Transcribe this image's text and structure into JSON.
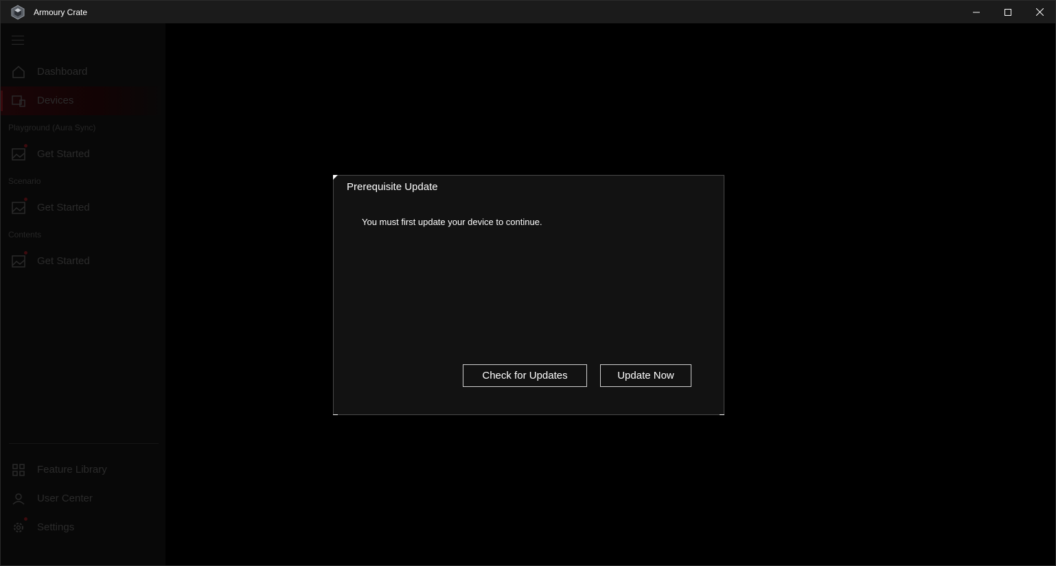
{
  "titlebar": {
    "title": "Armoury Crate",
    "minimize_icon": "minimize-icon",
    "maximize_icon": "maximize-icon",
    "close_icon": "close-icon"
  },
  "sidebar": {
    "items_top": [
      {
        "label": "Dashboard",
        "icon": "home-icon"
      },
      {
        "label": "Devices",
        "icon": "devices-icon",
        "active": true
      }
    ],
    "sections": [
      {
        "label": "Playground (Aura Sync)",
        "item": {
          "label": "Get Started",
          "icon": "image-icon"
        }
      },
      {
        "label": "Scenario",
        "item": {
          "label": "Get Started",
          "icon": "image-icon"
        }
      },
      {
        "label": "Contents",
        "item": {
          "label": "Get Started",
          "icon": "image-icon"
        }
      }
    ],
    "items_bottom": [
      {
        "label": "Feature Library",
        "icon": "grid-icon"
      },
      {
        "label": "User Center",
        "icon": "user-icon"
      },
      {
        "label": "Settings",
        "icon": "gear-icon"
      }
    ]
  },
  "dialog": {
    "title": "Prerequisite Update",
    "message": "You must first update your device to continue.",
    "check_button": "Check for Updates",
    "update_button": "Update Now"
  },
  "colors": {
    "background": "#000000",
    "dialog_bg": "#121212",
    "titlebar_bg": "#1b1b1b",
    "dimmed_text": "#2b2b2b",
    "accent_red": "#3d0b0e"
  }
}
